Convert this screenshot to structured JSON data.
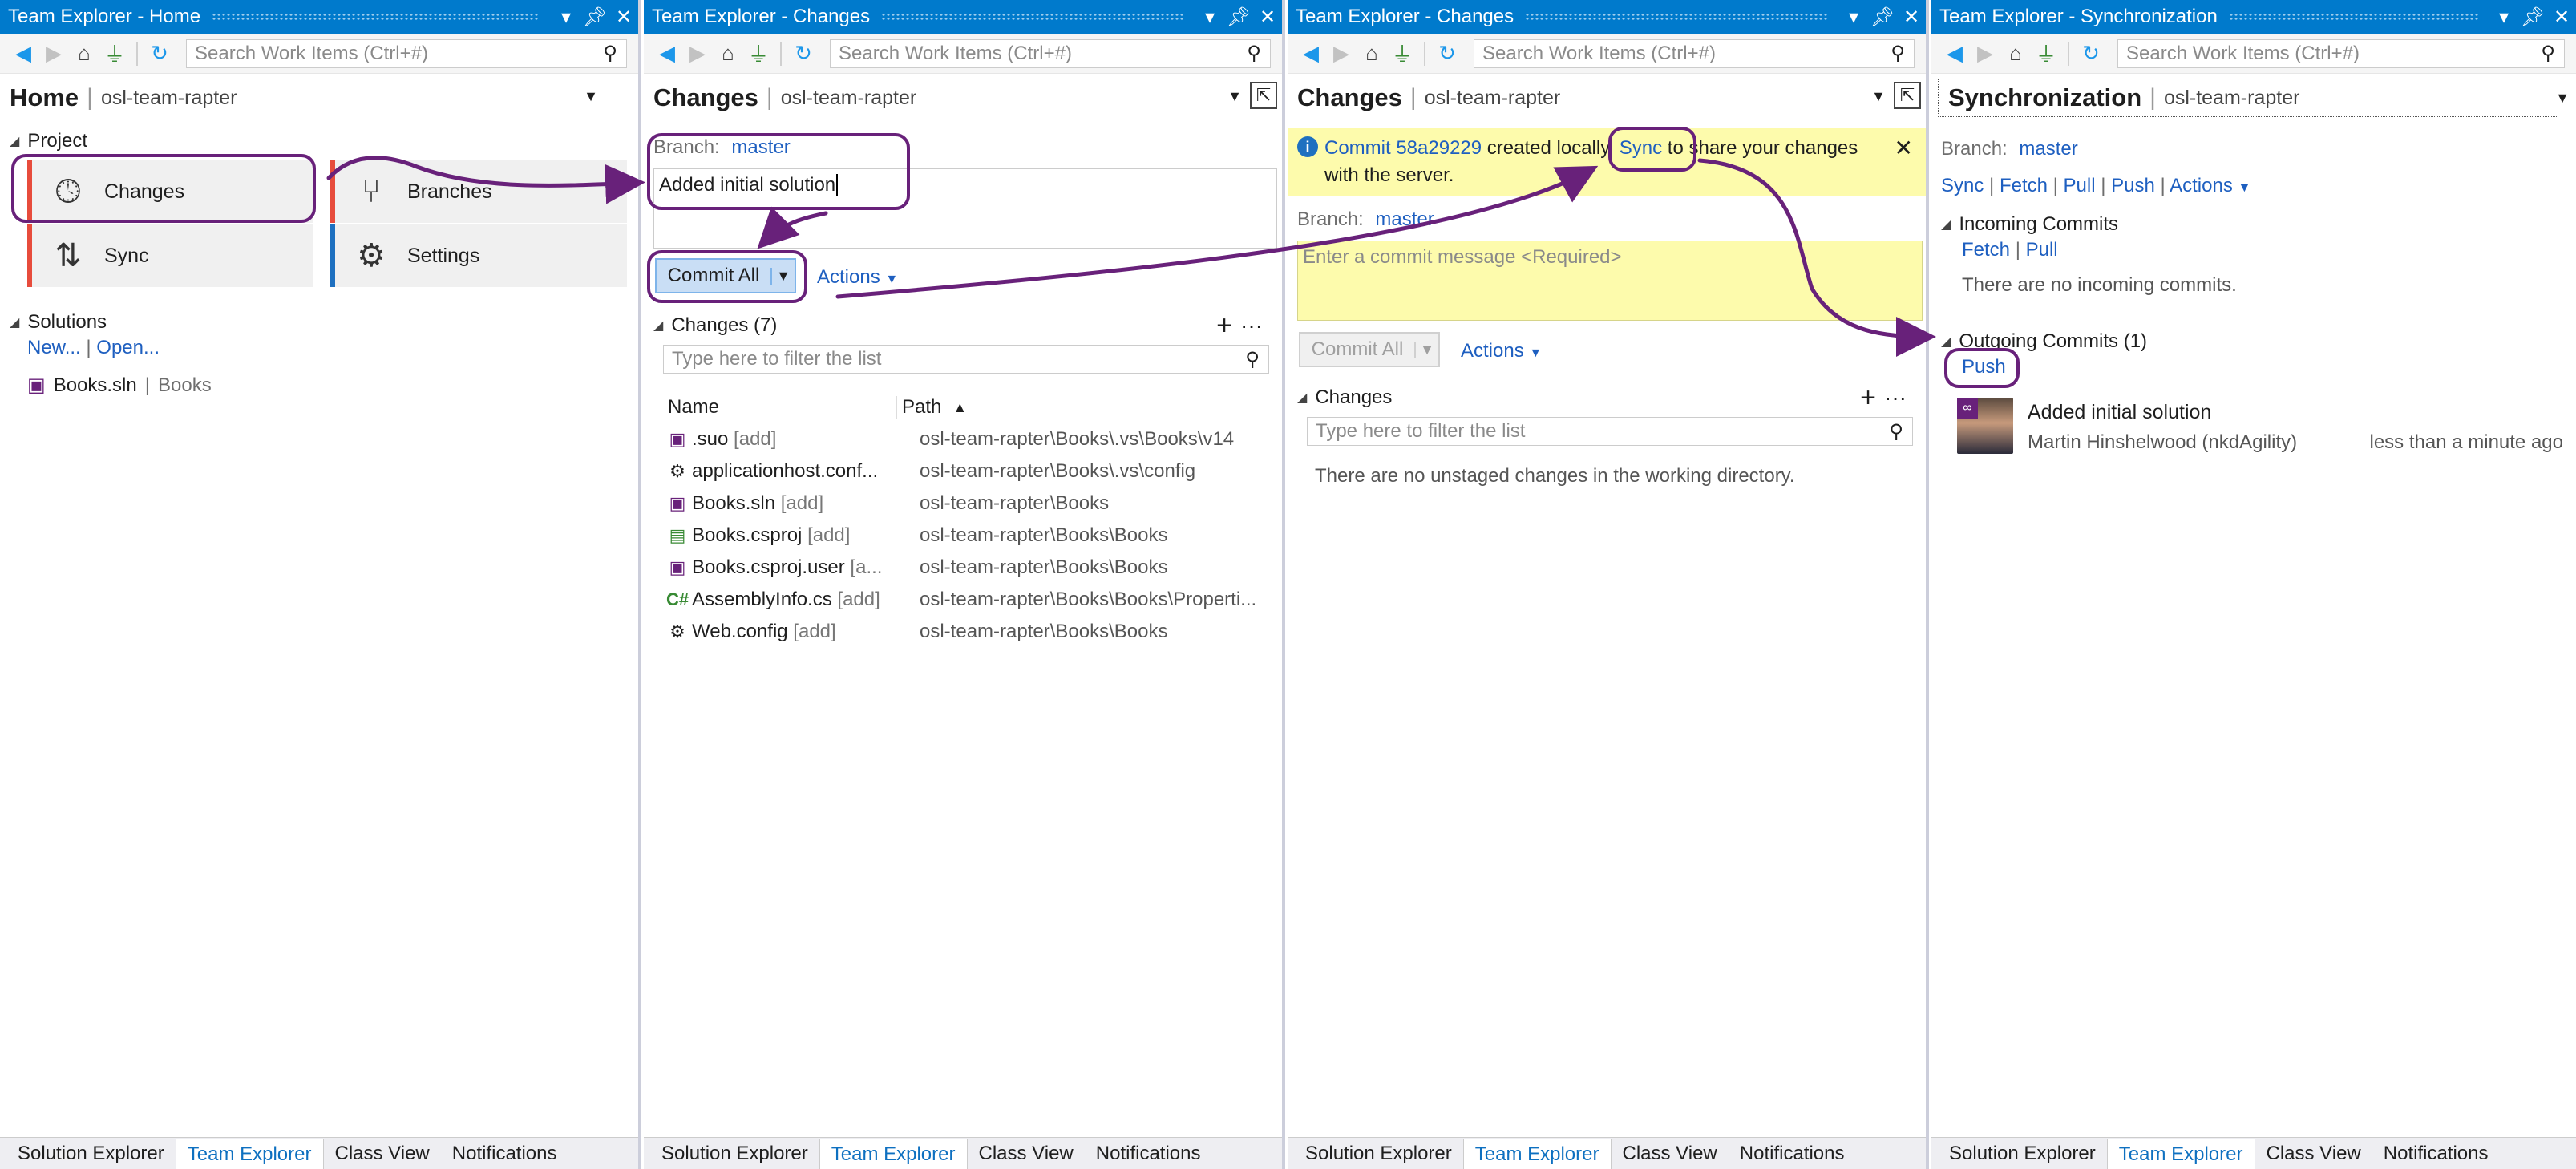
{
  "panels": [
    {
      "title": "Team Explorer - Home",
      "search_placeholder": "Search Work Items (Ctrl+#)",
      "page_title": "Home",
      "project": "osl-team-rapter",
      "project_section": "Project",
      "tiles": [
        {
          "label": "Changes",
          "icon": "clock-icon",
          "color": "#e74c3c"
        },
        {
          "label": "Branches",
          "icon": "branch-icon",
          "color": "#e74c3c"
        },
        {
          "label": "Sync",
          "icon": "sync-arrows-icon",
          "color": "#e74c3c"
        },
        {
          "label": "Settings",
          "icon": "gear-icon",
          "color": "#1e70c0"
        }
      ],
      "solutions_section": "Solutions",
      "new_link": "New...",
      "open_link": "Open...",
      "solution_file": "Books.sln",
      "solution_name": "Books"
    },
    {
      "title": "Team Explorer - Changes",
      "search_placeholder": "Search Work Items (Ctrl+#)",
      "page_title": "Changes",
      "project": "osl-team-rapter",
      "branch_label": "Branch:",
      "branch": "master",
      "commit_message": "Added initial solution",
      "commit_button": "Commit All",
      "actions_label": "Actions",
      "changes_header": "Changes (7)",
      "filter_placeholder": "Type here to filter the list",
      "col_name": "Name",
      "col_path": "Path",
      "files": [
        {
          "name": ".suo",
          "tag": "[add]",
          "path": "osl-team-rapter\\Books\\.vs\\Books\\v14"
        },
        {
          "name": "applicationhost.conf...",
          "tag": "",
          "path": "osl-team-rapter\\Books\\.vs\\config"
        },
        {
          "name": "Books.sln",
          "tag": "[add]",
          "path": "osl-team-rapter\\Books"
        },
        {
          "name": "Books.csproj",
          "tag": "[add]",
          "path": "osl-team-rapter\\Books\\Books"
        },
        {
          "name": "Books.csproj.user",
          "tag": "[a...",
          "path": "osl-team-rapter\\Books\\Books"
        },
        {
          "name": "AssemblyInfo.cs",
          "tag": "[add]",
          "path": "osl-team-rapter\\Books\\Books\\Properti..."
        },
        {
          "name": "Web.config",
          "tag": "[add]",
          "path": "osl-team-rapter\\Books\\Books"
        }
      ]
    },
    {
      "title": "Team Explorer - Changes",
      "search_placeholder": "Search Work Items (Ctrl+#)",
      "page_title": "Changes",
      "project": "osl-team-rapter",
      "info_commit_link": "Commit 58a29229",
      "info_text1": "created locally.",
      "info_sync_link": "Sync",
      "info_text2": "to share your changes",
      "info_text3": "with the server.",
      "branch_label": "Branch:",
      "branch": "master",
      "commit_placeholder": "Enter a commit message <Required>",
      "commit_button": "Commit All",
      "actions_label": "Actions",
      "changes_header": "Changes",
      "filter_placeholder": "Type here to filter the list",
      "empty_text": "There are no unstaged changes in the working directory."
    },
    {
      "title": "Team Explorer - Synchronization",
      "search_placeholder": "Search Work Items (Ctrl+#)",
      "page_title": "Synchronization",
      "project": "osl-team-rapter",
      "branch_label": "Branch:",
      "branch": "master",
      "sync_links": [
        "Sync",
        "Fetch",
        "Pull",
        "Push",
        "Actions"
      ],
      "incoming_header": "Incoming Commits",
      "incoming_links": [
        "Fetch",
        "Pull"
      ],
      "incoming_empty": "There are no incoming commits.",
      "outgoing_header": "Outgoing Commits (1)",
      "push_link": "Push",
      "commit_title": "Added initial solution",
      "commit_author": "Martin Hinshelwood (nkdAgility)",
      "commit_time": "less than a minute ago"
    }
  ],
  "tabs": [
    "Solution Explorer",
    "Team Explorer",
    "Class View",
    "Notifications"
  ],
  "colors": {
    "accent": "#007acc",
    "annotation": "#68217a",
    "info_bar": "#fdfbac"
  }
}
